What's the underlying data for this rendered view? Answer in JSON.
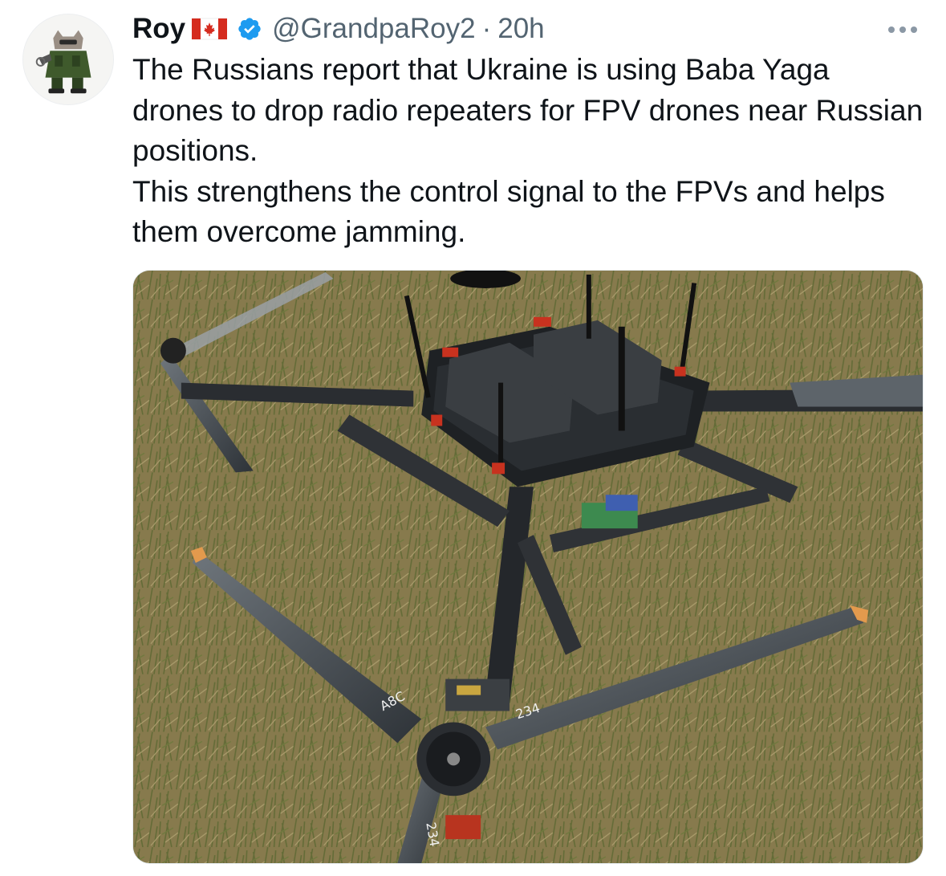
{
  "author": {
    "name": "Roy",
    "flag": "canada-flag",
    "verified": true,
    "handle": "@GrandpaRoy2",
    "separator": "·",
    "time": "20h"
  },
  "tweet": {
    "lines": [
      "The Russians report that Ukraine is using Baba Yaga drones to drop radio repeaters for FPV drones near Russian positions.",
      "This strengthens the control signal to the FPVs and helps them overcome jamming."
    ]
  },
  "media": {
    "type": "photo",
    "prop_markings": [
      "A8C",
      "234",
      "234"
    ]
  },
  "colors": {
    "text": "#0f1419",
    "secondary": "#536471",
    "verified_blue": "#1d9bf0",
    "canada_red": "#d52b1e"
  }
}
